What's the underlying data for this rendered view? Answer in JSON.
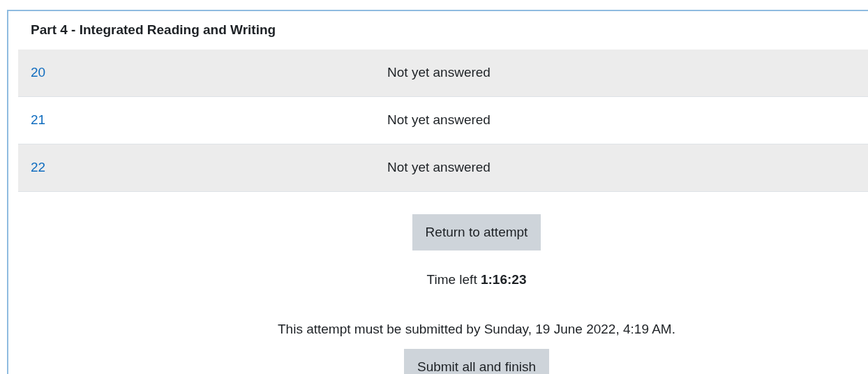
{
  "section": {
    "title": "Part 4 - Integrated Reading and Writing"
  },
  "rows": [
    {
      "question": "20",
      "status": "Not yet answered"
    },
    {
      "question": "21",
      "status": "Not yet answered"
    },
    {
      "question": "22",
      "status": "Not yet answered"
    }
  ],
  "return_button": "Return to attempt",
  "time_left": {
    "label": "Time left",
    "value": "1:16:23"
  },
  "deadline_note": "This attempt must be submitted by Sunday, 19 June 2022, 4:19 AM.",
  "submit_button": "Submit all and finish"
}
